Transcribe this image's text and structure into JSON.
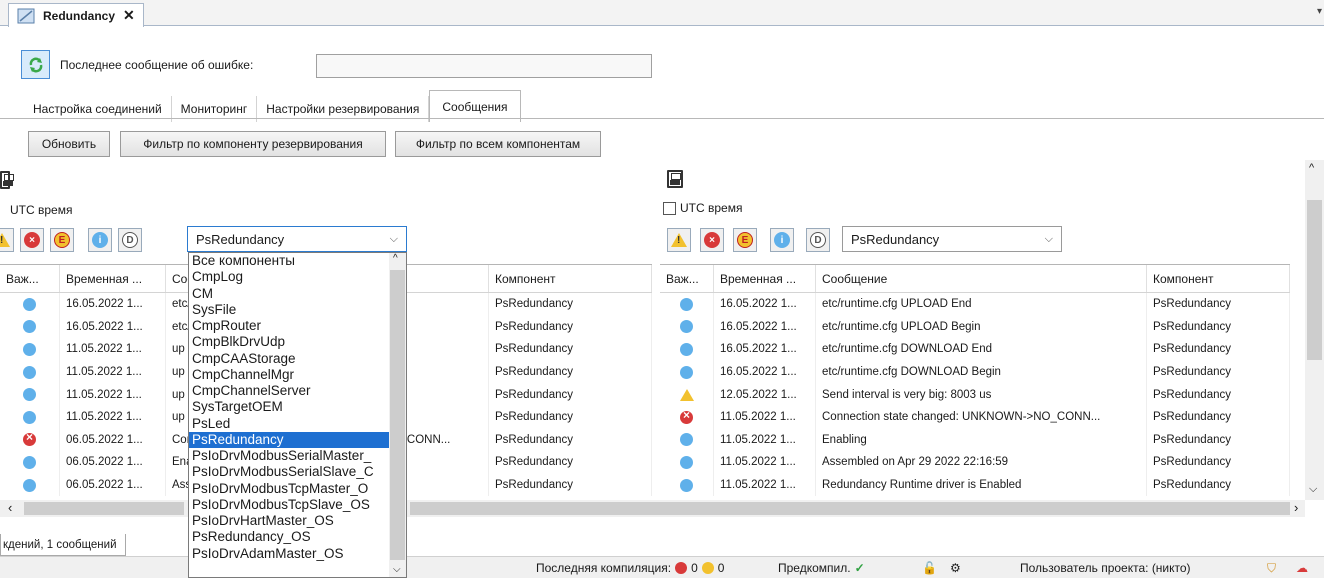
{
  "doc_tab": {
    "title": "Redundancy",
    "close": "✕"
  },
  "error_bar": {
    "label": "Последнее сообщение об ошибке:",
    "value": ""
  },
  "subtabs": [
    "Настройка соединений",
    "Мониторинг",
    "Настройки резервирования",
    "Сообщения"
  ],
  "active_subtab": "Сообщения",
  "buttons": {
    "refresh": "Обновить",
    "filter_redundancy": "Фильтр по компоненту резервирования",
    "filter_all": "Фильтр по всем компонентам"
  },
  "left_pane": {
    "utc_label": "UTC время",
    "combo_value": "PsRedundancy",
    "columns": [
      "Важ...",
      "Временная ...",
      "Сообщение",
      "Компонент"
    ],
    "rows": [
      {
        "severity": "info",
        "time": "16.05.2022 1...",
        "message": "etc/runtime.cfg UPLOAD End",
        "component": "PsRedundancy"
      },
      {
        "severity": "info",
        "time": "16.05.2022 1...",
        "message": "etc/runtime.cfg UPLOAD Begin",
        "component": "PsRedundancy"
      },
      {
        "severity": "info",
        "time": "11.05.2022 1...",
        "message": "up",
        "component": "PsRedundancy"
      },
      {
        "severity": "info",
        "time": "11.05.2022 1...",
        "message": "up",
        "component": "PsRedundancy"
      },
      {
        "severity": "info",
        "time": "11.05.2022 1...",
        "message": "up",
        "component": "PsRedundancy"
      },
      {
        "severity": "info",
        "time": "11.05.2022 1...",
        "message": "up",
        "component": "PsRedundancy"
      },
      {
        "severity": "error",
        "time": "06.05.2022 1...",
        "message": "Connection state changed: UNKNOWN->NO_CONN...",
        "component": "PsRedundancy"
      },
      {
        "severity": "info",
        "time": "06.05.2022 1...",
        "message": "Enabling",
        "component": "PsRedundancy"
      },
      {
        "severity": "info",
        "time": "06.05.2022 1...",
        "message": "Assembled on Apr 29 2022 22:16:59",
        "component": "PsRedundancy"
      }
    ]
  },
  "dropdown_options": [
    "Все компоненты",
    "CmpLog",
    "CM",
    "SysFile",
    "CmpRouter",
    "CmpBlkDrvUdp",
    "CmpCAAStorage",
    "CmpChannelMgr",
    "CmpChannelServer",
    "SysTargetOEM",
    "PsLed",
    "PsRedundancy",
    "PsIoDrvModbusSerialMaster_",
    "PsIoDrvModbusSerialSlave_C",
    "PsIoDrvModbusTcpMaster_O",
    "PsIoDrvModbusTcpSlave_OS",
    "PsIoDrvHartMaster_OS",
    "PsRedundancy_OS",
    "PsIoDrvAdamMaster_OS"
  ],
  "dropdown_selected": "PsRedundancy",
  "right_pane": {
    "utc_label": "UTC время",
    "combo_value": "PsRedundancy",
    "columns": [
      "Важ...",
      "Временная ...",
      "Сообщение",
      "Компонент"
    ],
    "rows": [
      {
        "severity": "info",
        "time": "16.05.2022 1...",
        "message": "etc/runtime.cfg UPLOAD End",
        "component": "PsRedundancy"
      },
      {
        "severity": "info",
        "time": "16.05.2022 1...",
        "message": "etc/runtime.cfg UPLOAD Begin",
        "component": "PsRedundancy"
      },
      {
        "severity": "info",
        "time": "16.05.2022 1...",
        "message": "etc/runtime.cfg DOWNLOAD End",
        "component": "PsRedundancy"
      },
      {
        "severity": "info",
        "time": "16.05.2022 1...",
        "message": "etc/runtime.cfg DOWNLOAD Begin",
        "component": "PsRedundancy"
      },
      {
        "severity": "warning",
        "time": "12.05.2022 1...",
        "message": "Send interval is very big: 8003 us",
        "component": "PsRedundancy"
      },
      {
        "severity": "error",
        "time": "11.05.2022 1...",
        "message": "Connection state changed: UNKNOWN->NO_CONN...",
        "component": "PsRedundancy"
      },
      {
        "severity": "info",
        "time": "11.05.2022 1...",
        "message": "Enabling",
        "component": "PsRedundancy"
      },
      {
        "severity": "info",
        "time": "11.05.2022 1...",
        "message": "Assembled on Apr 29 2022 22:16:59",
        "component": "PsRedundancy"
      },
      {
        "severity": "info",
        "time": "11.05.2022 1...",
        "message": "Redundancy Runtime driver is Enabled",
        "component": "PsRedundancy"
      }
    ]
  },
  "bottom_tab": "кдений, 1 сообщений",
  "status": {
    "last_compile": "Последняя компиляция:",
    "errors": "0",
    "warnings": "0",
    "precompile": "Предкомпил.",
    "project_user": "Пользователь проекта: (никто)"
  }
}
